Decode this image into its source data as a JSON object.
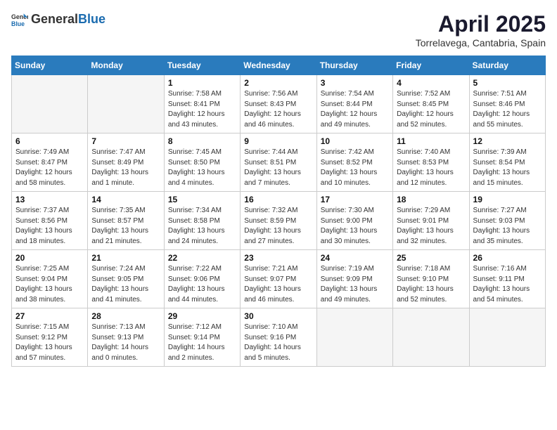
{
  "header": {
    "logo_general": "General",
    "logo_blue": "Blue",
    "month_title": "April 2025",
    "location": "Torrelavega, Cantabria, Spain"
  },
  "days_of_week": [
    "Sunday",
    "Monday",
    "Tuesday",
    "Wednesday",
    "Thursday",
    "Friday",
    "Saturday"
  ],
  "weeks": [
    [
      {
        "day": "",
        "empty": true
      },
      {
        "day": "",
        "empty": true
      },
      {
        "day": "1",
        "sunrise": "7:58 AM",
        "sunset": "8:41 PM",
        "daylight": "12 hours and 43 minutes."
      },
      {
        "day": "2",
        "sunrise": "7:56 AM",
        "sunset": "8:43 PM",
        "daylight": "12 hours and 46 minutes."
      },
      {
        "day": "3",
        "sunrise": "7:54 AM",
        "sunset": "8:44 PM",
        "daylight": "12 hours and 49 minutes."
      },
      {
        "day": "4",
        "sunrise": "7:52 AM",
        "sunset": "8:45 PM",
        "daylight": "12 hours and 52 minutes."
      },
      {
        "day": "5",
        "sunrise": "7:51 AM",
        "sunset": "8:46 PM",
        "daylight": "12 hours and 55 minutes."
      }
    ],
    [
      {
        "day": "6",
        "sunrise": "7:49 AM",
        "sunset": "8:47 PM",
        "daylight": "12 hours and 58 minutes."
      },
      {
        "day": "7",
        "sunrise": "7:47 AM",
        "sunset": "8:49 PM",
        "daylight": "13 hours and 1 minute."
      },
      {
        "day": "8",
        "sunrise": "7:45 AM",
        "sunset": "8:50 PM",
        "daylight": "13 hours and 4 minutes."
      },
      {
        "day": "9",
        "sunrise": "7:44 AM",
        "sunset": "8:51 PM",
        "daylight": "13 hours and 7 minutes."
      },
      {
        "day": "10",
        "sunrise": "7:42 AM",
        "sunset": "8:52 PM",
        "daylight": "13 hours and 10 minutes."
      },
      {
        "day": "11",
        "sunrise": "7:40 AM",
        "sunset": "8:53 PM",
        "daylight": "13 hours and 12 minutes."
      },
      {
        "day": "12",
        "sunrise": "7:39 AM",
        "sunset": "8:54 PM",
        "daylight": "13 hours and 15 minutes."
      }
    ],
    [
      {
        "day": "13",
        "sunrise": "7:37 AM",
        "sunset": "8:56 PM",
        "daylight": "13 hours and 18 minutes."
      },
      {
        "day": "14",
        "sunrise": "7:35 AM",
        "sunset": "8:57 PM",
        "daylight": "13 hours and 21 minutes."
      },
      {
        "day": "15",
        "sunrise": "7:34 AM",
        "sunset": "8:58 PM",
        "daylight": "13 hours and 24 minutes."
      },
      {
        "day": "16",
        "sunrise": "7:32 AM",
        "sunset": "8:59 PM",
        "daylight": "13 hours and 27 minutes."
      },
      {
        "day": "17",
        "sunrise": "7:30 AM",
        "sunset": "9:00 PM",
        "daylight": "13 hours and 30 minutes."
      },
      {
        "day": "18",
        "sunrise": "7:29 AM",
        "sunset": "9:01 PM",
        "daylight": "13 hours and 32 minutes."
      },
      {
        "day": "19",
        "sunrise": "7:27 AM",
        "sunset": "9:03 PM",
        "daylight": "13 hours and 35 minutes."
      }
    ],
    [
      {
        "day": "20",
        "sunrise": "7:25 AM",
        "sunset": "9:04 PM",
        "daylight": "13 hours and 38 minutes."
      },
      {
        "day": "21",
        "sunrise": "7:24 AM",
        "sunset": "9:05 PM",
        "daylight": "13 hours and 41 minutes."
      },
      {
        "day": "22",
        "sunrise": "7:22 AM",
        "sunset": "9:06 PM",
        "daylight": "13 hours and 44 minutes."
      },
      {
        "day": "23",
        "sunrise": "7:21 AM",
        "sunset": "9:07 PM",
        "daylight": "13 hours and 46 minutes."
      },
      {
        "day": "24",
        "sunrise": "7:19 AM",
        "sunset": "9:09 PM",
        "daylight": "13 hours and 49 minutes."
      },
      {
        "day": "25",
        "sunrise": "7:18 AM",
        "sunset": "9:10 PM",
        "daylight": "13 hours and 52 minutes."
      },
      {
        "day": "26",
        "sunrise": "7:16 AM",
        "sunset": "9:11 PM",
        "daylight": "13 hours and 54 minutes."
      }
    ],
    [
      {
        "day": "27",
        "sunrise": "7:15 AM",
        "sunset": "9:12 PM",
        "daylight": "13 hours and 57 minutes."
      },
      {
        "day": "28",
        "sunrise": "7:13 AM",
        "sunset": "9:13 PM",
        "daylight": "14 hours and 0 minutes."
      },
      {
        "day": "29",
        "sunrise": "7:12 AM",
        "sunset": "9:14 PM",
        "daylight": "14 hours and 2 minutes."
      },
      {
        "day": "30",
        "sunrise": "7:10 AM",
        "sunset": "9:16 PM",
        "daylight": "14 hours and 5 minutes."
      },
      {
        "day": "",
        "empty": true
      },
      {
        "day": "",
        "empty": true
      },
      {
        "day": "",
        "empty": true
      }
    ]
  ],
  "labels": {
    "sunrise": "Sunrise:",
    "sunset": "Sunset:",
    "daylight": "Daylight:"
  }
}
